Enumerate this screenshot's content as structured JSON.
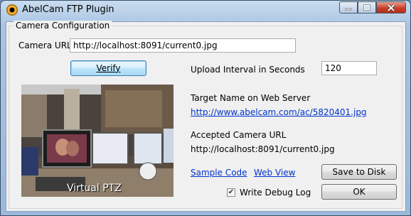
{
  "window": {
    "title": "AbelCam FTP Plugin",
    "icon": "abelcam-eye-icon"
  },
  "group": {
    "title": "Camera Configuration"
  },
  "camera_url": {
    "label": "Camera URL",
    "value": "http://localhost:8091/current0.jpg"
  },
  "verify_button": {
    "label": "Verify"
  },
  "upload_interval": {
    "label": "Upload Interval in Seconds",
    "value": "120"
  },
  "target_name": {
    "label": "Target Name on Web Server",
    "link": "http://www.abelcam.com/ac/5820401.jpg"
  },
  "accepted_url": {
    "label": "Accepted Camera URL",
    "value": "http://localhost:8091/current0.jpg"
  },
  "links": {
    "sample_code": "Sample Code",
    "web_view": "Web View"
  },
  "save_button": {
    "label": "Save to Disk"
  },
  "debug": {
    "label": "Write Debug Log",
    "checked": true
  },
  "ok_button": {
    "label": "OK"
  },
  "preview": {
    "overlay_text": "Virtual PTZ"
  }
}
